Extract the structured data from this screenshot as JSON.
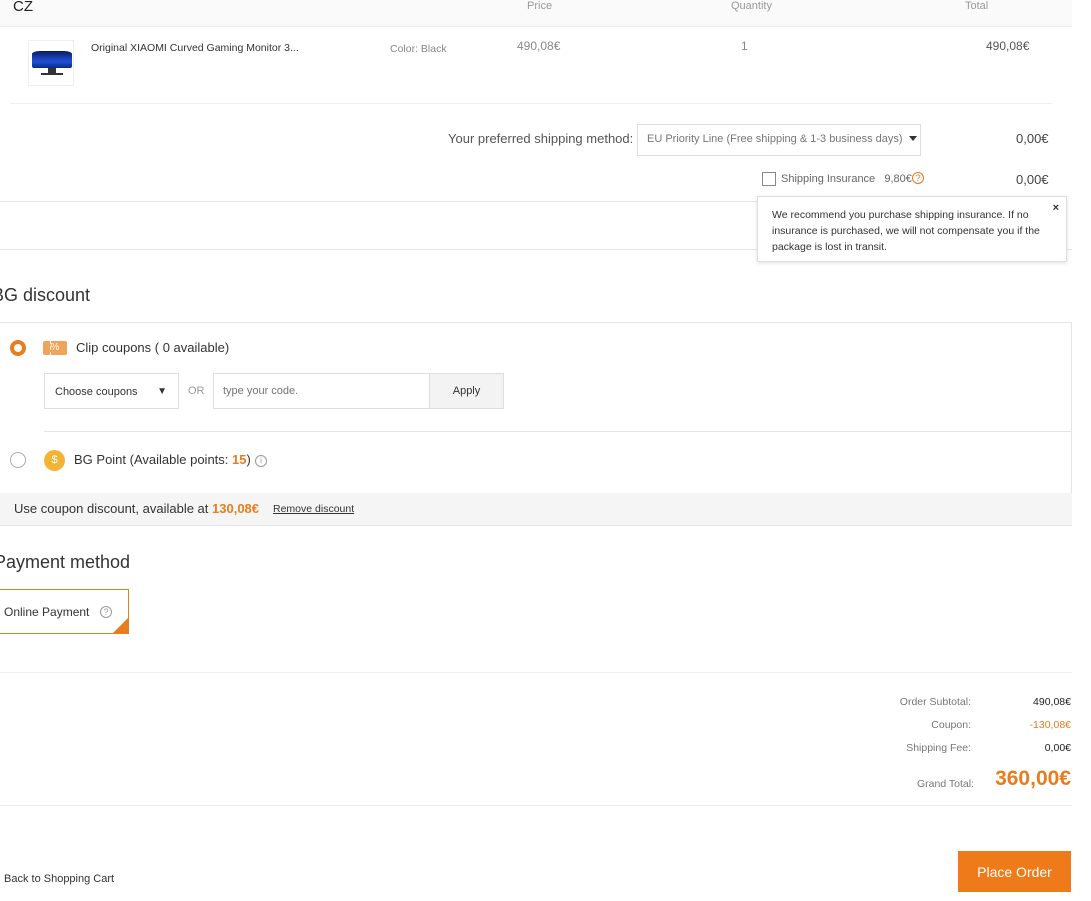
{
  "cart_header": {
    "country": "CZ",
    "col_price": "Price",
    "col_quantity": "Quantity",
    "col_total": "Total"
  },
  "item": {
    "name": "Original XIAOMI Curved Gaming Monitor 3...",
    "color": "Color: Black",
    "price": "490,08€",
    "quantity": "1",
    "total": "490,08€"
  },
  "shipping": {
    "label": "Your preferred shipping method:",
    "method": "EU Priority Line (Free shipping & 1-3 business days)",
    "cost": "0,00€",
    "insurance_label": "Shipping Insurance",
    "insurance_price": "9,80€",
    "insurance_cost": "0,00€",
    "insurance_checked": false,
    "tooltip": "We recommend you purchase shipping insurance. If no insurance is purchased, we will not compensate you if the package is lost in transit.",
    "tooltip_close": "×"
  },
  "discount": {
    "title": "BG discount",
    "clip_label": "Clip coupons ( 0 available)",
    "choose_placeholder": "Choose coupons",
    "or_text": "OR",
    "code_placeholder": "type your code.",
    "apply_label": "Apply",
    "bg_point_prefix": "BG Point (Available points: ",
    "bg_points": "15",
    "bg_point_suffix": ")",
    "available_prefix": "Use coupon discount, available at ",
    "available_amount": "130,08€",
    "remove_label": "Remove discount",
    "selected": "clip_coupons"
  },
  "payment": {
    "title": "Payment method",
    "option": "Online Payment"
  },
  "summary": {
    "subtotal_label": "Order Subtotal:",
    "subtotal": "490,08€",
    "coupon_label": "Coupon:",
    "coupon": "-130,08€",
    "shipping_label": "Shipping Fee:",
    "shipping": "0,00€",
    "grand_label": "Grand Total:",
    "grand": "360,00€"
  },
  "footer": {
    "back_label": "Back to Shopping Cart",
    "place_order": "Place Order"
  },
  "colors": {
    "accent": "#ef7a1a",
    "coupon_orange": "#e77d1f"
  },
  "icons": [
    "monitor-thumbnail",
    "help-icon",
    "close-icon",
    "coupon-icon",
    "coin-icon",
    "info-icon",
    "check-icon",
    "caret-down-icon"
  ]
}
